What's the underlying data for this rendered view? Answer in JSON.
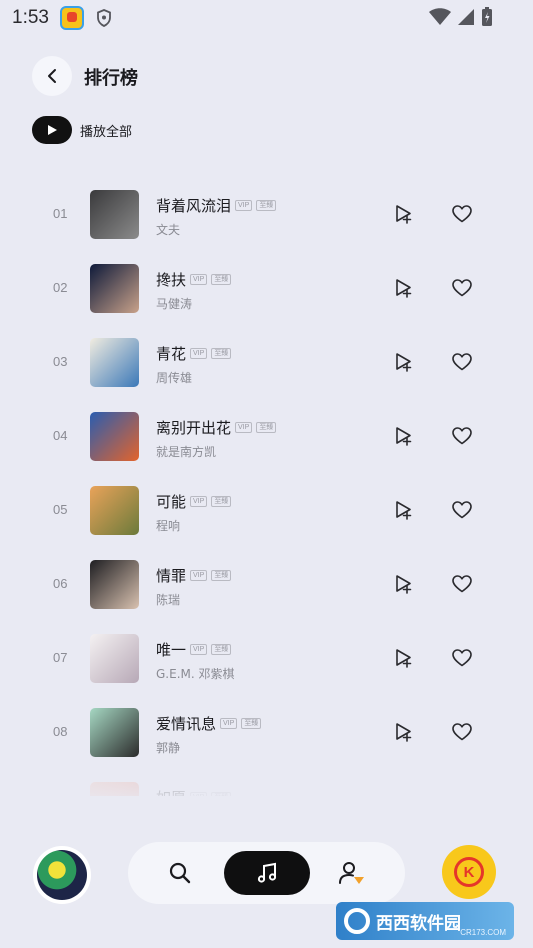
{
  "status_bar": {
    "time": "1:53"
  },
  "header": {
    "title": "排行榜"
  },
  "play_all": {
    "label": "播放全部"
  },
  "tags": {
    "vip": "VIP",
    "hq": "至臻"
  },
  "songs": [
    {
      "rank": "01",
      "title": "背着风流泪",
      "artist": "文夫",
      "cover_colors": [
        "#3a3a3c",
        "#8b8b8b"
      ]
    },
    {
      "rank": "02",
      "title": "搀扶",
      "artist": "马健涛",
      "cover_colors": [
        "#0e1a3a",
        "#c9a28a"
      ]
    },
    {
      "rank": "03",
      "title": "青花",
      "artist": "周传雄",
      "cover_colors": [
        "#f1ece0",
        "#3b78b8"
      ]
    },
    {
      "rank": "04",
      "title": "离别开出花",
      "artist": "就是南方凯",
      "cover_colors": [
        "#2a5db0",
        "#e3642c"
      ]
    },
    {
      "rank": "05",
      "title": "可能",
      "artist": "程响",
      "cover_colors": [
        "#e9a35a",
        "#6b7a3a"
      ]
    },
    {
      "rank": "06",
      "title": "情罪",
      "artist": "陈瑞",
      "cover_colors": [
        "#1e1e22",
        "#d9c2b0"
      ]
    },
    {
      "rank": "07",
      "title": "唯一",
      "artist": "G.E.M. 邓紫棋",
      "cover_colors": [
        "#f4f1f2",
        "#b7a8b6"
      ]
    },
    {
      "rank": "08",
      "title": "爱情讯息",
      "artist": "郭静",
      "cover_colors": [
        "#a6d8c3",
        "#2b2b2b"
      ]
    },
    {
      "rank": "",
      "title": "如愿",
      "artist": "",
      "cover_colors": [
        "#f2c0b0",
        "#e48b7a"
      ]
    }
  ],
  "colors": {
    "background": "#e9eaf3",
    "accent_dark": "#0f0f10",
    "k_yellow": "#f8c81b",
    "k_red": "#e5362a"
  },
  "icons": {
    "back": "chevron-left-icon",
    "play": "play-icon",
    "add_to_playlist": "add-to-playlist-icon",
    "favorite": "heart-icon",
    "search": "search-icon",
    "music": "music-note-icon",
    "profile": "profile-icon"
  },
  "bottom_nav": {
    "k_label": "K"
  },
  "watermark": {
    "text": "西西软件园",
    "sub": "CR173.COM"
  }
}
